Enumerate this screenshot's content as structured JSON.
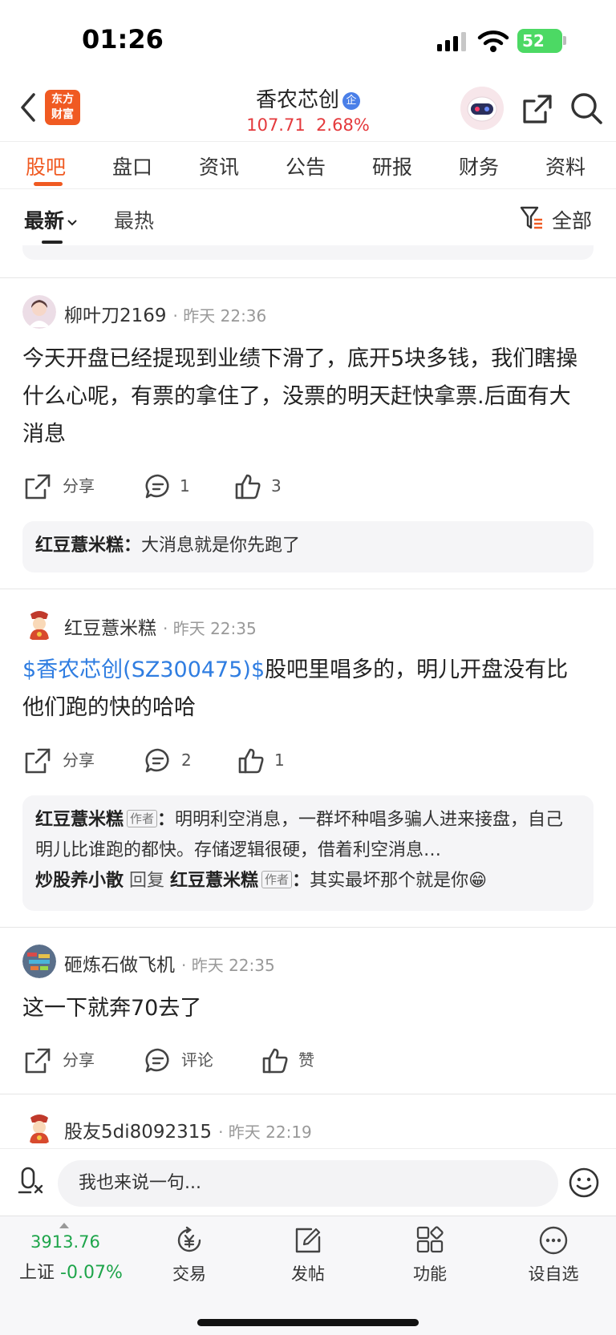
{
  "status_bar": {
    "time": "01:26",
    "battery": "52"
  },
  "header": {
    "logo_line1": "东方",
    "logo_line2": "财富",
    "title": "香农芯创",
    "verified_badge": "企",
    "price": "107.71",
    "change_pct": "2.68%"
  },
  "tabs": [
    {
      "label": "股吧",
      "active": true
    },
    {
      "label": "盘口"
    },
    {
      "label": "资讯"
    },
    {
      "label": "公告"
    },
    {
      "label": "研报"
    },
    {
      "label": "财务"
    },
    {
      "label": "资料"
    }
  ],
  "sort": {
    "latest": "最新",
    "hot": "最热",
    "filter": "全部"
  },
  "posts": [
    {
      "author": "柳叶刀2169",
      "time": "· 昨天 22:36",
      "body": "今天开盘已经提现到业绩下滑了，底开5块多钱，我们瞎操什么心呢，有票的拿住了，没票的明天赶快拿票.后面有大消息",
      "share": "分享",
      "comments": "1",
      "likes": "3",
      "replies": [
        {
          "name": "红豆薏米糕",
          "sep": "：",
          "text": "大消息就是你先跑了"
        }
      ]
    },
    {
      "author": "红豆薏米糕",
      "time": "· 昨天 22:35",
      "stock_tag": "$香农芯创(SZ300475)$",
      "body": "股吧里唱多的，明儿开盘没有比他们跑的快的哈哈",
      "share": "分享",
      "comments": "2",
      "likes": "1",
      "replies": [
        {
          "name": "红豆薏米糕",
          "tag": "作者",
          "sep": "：",
          "text": "明明利空消息，一群坏种唱多骗人进来接盘，自己明儿比谁跑的都快。存储逻辑很硬，借着利空消息…"
        },
        {
          "name": "炒股养小散",
          "reply_word": "回复",
          "target": "红豆薏米糕",
          "tag": "作者",
          "sep": "：",
          "text": "其实最坏那个就是你😁"
        }
      ]
    },
    {
      "author": "砸炼石做飞机",
      "time": "· 昨天 22:35",
      "body": "这一下就奔70去了",
      "share": "分享",
      "comments": "评论",
      "likes": "赞"
    },
    {
      "author": "股友5di8092315",
      "time": "· 昨天 22:19"
    }
  ],
  "input": {
    "placeholder": "我也来说一句..."
  },
  "bottom_nav": {
    "index_value": "3913.76",
    "index_name": "上证",
    "index_change": "-0.07%",
    "items": [
      "交易",
      "发帖",
      "功能",
      "设自选"
    ]
  },
  "colors": {
    "accent": "#f05a22",
    "up": "#e4393c",
    "down": "#1ea54b",
    "link": "#2f7de1"
  }
}
